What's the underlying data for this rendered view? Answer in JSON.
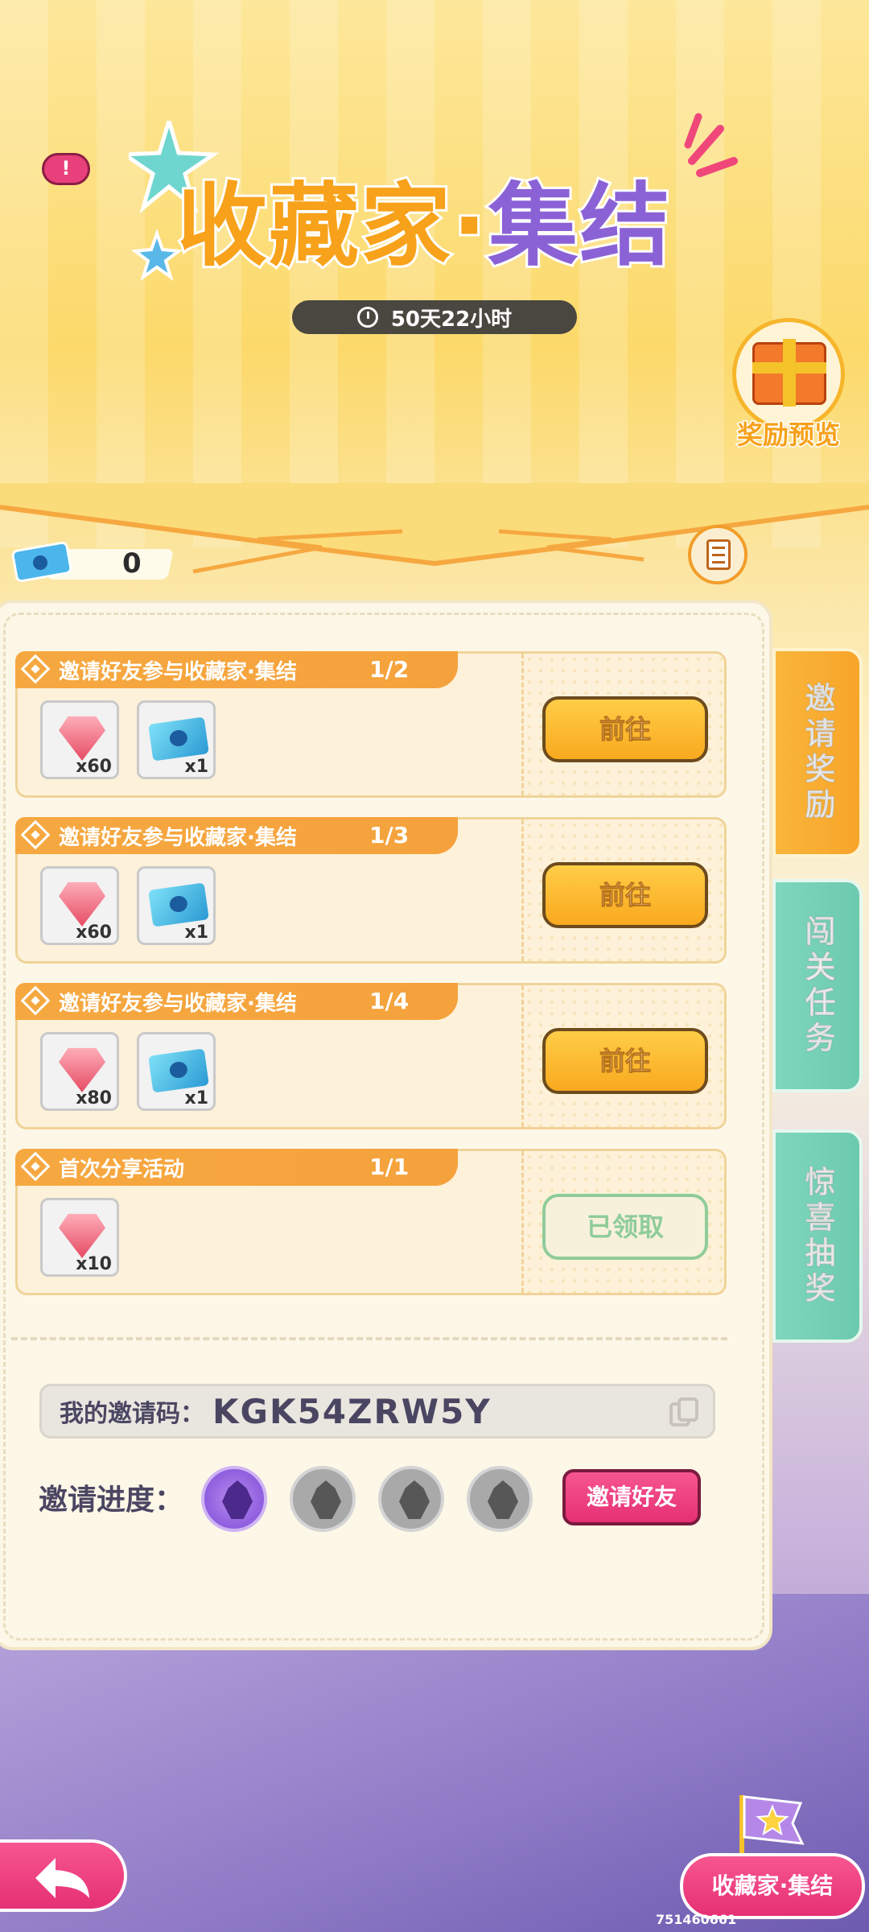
{
  "header": {
    "title_part_a": "收藏家·",
    "title_part_b": "集结",
    "timer": "50天22小时",
    "alert_label": "!",
    "reward_preview_label": "奖励预览"
  },
  "currency": {
    "ticket_count": "0"
  },
  "tasks": [
    {
      "title": "邀请好友参与收藏家·集结",
      "progress": "1/2",
      "rewards": [
        {
          "icon": "gem-icon",
          "qty": "x60"
        },
        {
          "icon": "ticket-icon",
          "qty": "x1"
        }
      ],
      "action": "前往"
    },
    {
      "title": "邀请好友参与收藏家·集结",
      "progress": "1/3",
      "rewards": [
        {
          "icon": "gem-icon",
          "qty": "x60"
        },
        {
          "icon": "ticket-icon",
          "qty": "x1"
        }
      ],
      "action": "前往"
    },
    {
      "title": "邀请好友参与收藏家·集结",
      "progress": "1/4",
      "rewards": [
        {
          "icon": "gem-icon",
          "qty": "x80"
        },
        {
          "icon": "ticket-icon",
          "qty": "x1"
        }
      ],
      "action": "前往"
    },
    {
      "title": "首次分享活动",
      "progress": "1/1",
      "rewards": [
        {
          "icon": "gem-icon",
          "qty": "x10"
        }
      ],
      "action": "已领取"
    }
  ],
  "invite": {
    "code_label": "我的邀请码：",
    "code_value": "KGK54ZRW5Y",
    "progress_label": "邀请进度：",
    "invite_button": "邀请好友",
    "progress_done": 1,
    "progress_total": 4
  },
  "side_tabs": [
    {
      "label": "邀请奖励",
      "active": true
    },
    {
      "label": "闯关任务",
      "active": false
    },
    {
      "label": "惊喜抽奖",
      "active": false
    }
  ],
  "footer": {
    "home_label": "收藏家·集结",
    "build_id": "751460661"
  },
  "colors": {
    "accent_orange": "#f7a21a",
    "accent_purple": "#8b62d6",
    "button_pink": "#e53075",
    "tab_green": "#6ccaae"
  }
}
